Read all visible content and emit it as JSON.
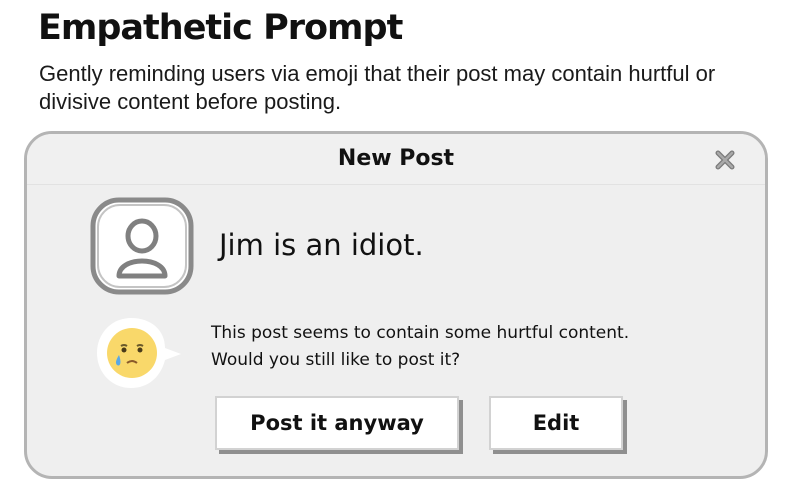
{
  "header": {
    "title": "Empathetic Prompt",
    "subtitle": "Gently reminding users via emoji that their post may contain hurtful or divisive content before posting."
  },
  "dialog": {
    "title": "New Post",
    "close_icon": "close-x-icon",
    "post_text": "Jim is an idiot.",
    "avatar_icon": "user-avatar-icon",
    "emoji_icon": "sad-crying-face-icon",
    "warning_line1": "This post seems to contain some hurtful content.",
    "warning_line2": "Would you still like to post it?",
    "post_anyway_label": "Post it anyway",
    "edit_label": "Edit"
  },
  "colors": {
    "dialog_bg": "#efefef",
    "dialog_border": "#b4b4b4",
    "emoji_face": "#f9d86a",
    "button_shadow": "#8f8f8f"
  }
}
